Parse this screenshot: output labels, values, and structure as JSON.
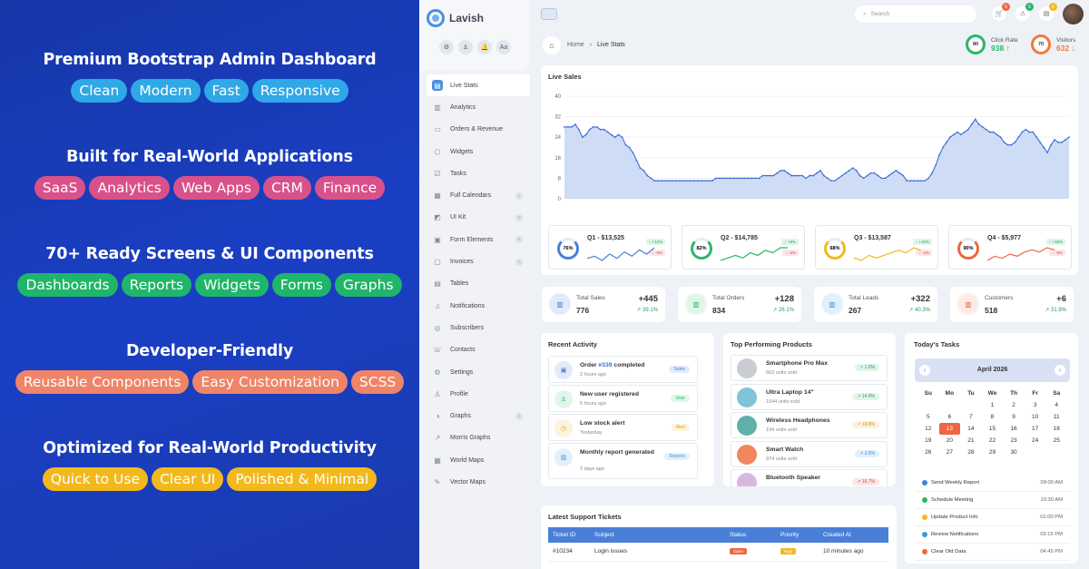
{
  "promo": {
    "sections": [
      {
        "title": "Premium Bootstrap Admin Dashboard",
        "pills": [
          "Clean",
          "Modern",
          "Fast",
          "Responsive"
        ],
        "color": "#2fa8e8"
      },
      {
        "title": "Built for Real-World Applications",
        "pills": [
          "SaaS",
          "Analytics",
          "Web Apps",
          "CRM",
          "Finance"
        ],
        "color": "#d9518a"
      },
      {
        "title": "70+ Ready Screens & UI Components",
        "pills": [
          "Dashboards",
          "Reports",
          "Widgets",
          "Forms",
          "Graphs"
        ],
        "color": "#1fb56a"
      },
      {
        "title": "Developer-Friendly",
        "pills": [
          "Reusable Components",
          "Easy Customization",
          "SCSS"
        ],
        "color": "#ef8468"
      },
      {
        "title": "Optimized for Real-World Productivity",
        "pills": [
          "Quick to Use",
          "Clear UI",
          "Polished & Minimal"
        ],
        "color": "#f2b91d"
      }
    ]
  },
  "brand": {
    "name": "Lavish"
  },
  "side_icons": [
    "⚙",
    "♙",
    "🔔",
    "Aa"
  ],
  "nav": [
    {
      "label": "Live Stats",
      "icon": "▤",
      "active": true
    },
    {
      "label": "Analytics",
      "icon": "▥"
    },
    {
      "label": "Orders & Revenue",
      "icon": "▭"
    },
    {
      "label": "Widgets",
      "icon": "⬡"
    },
    {
      "label": "Tasks",
      "icon": "☑"
    },
    {
      "label": "Full Calendars",
      "icon": "▦",
      "badge": "›"
    },
    {
      "label": "UI Kit",
      "icon": "◩",
      "badge": "›"
    },
    {
      "label": "Form Elements",
      "icon": "▣",
      "badge": "›"
    },
    {
      "label": "Invoices",
      "icon": "▢",
      "badge": "›"
    },
    {
      "label": "Tables",
      "icon": "▤"
    },
    {
      "label": "Notifications",
      "icon": "♫"
    },
    {
      "label": "Subscribers",
      "icon": "◎"
    },
    {
      "label": "Contacts",
      "icon": "☏"
    },
    {
      "label": "Settings",
      "icon": "⚙"
    },
    {
      "label": "Profile",
      "icon": "♙"
    },
    {
      "label": "Graphs",
      "icon": "◑",
      "badge": "›"
    },
    {
      "label": "Morris Graphs",
      "icon": "↗"
    },
    {
      "label": "World Maps",
      "icon": "▦"
    },
    {
      "label": "Vector Maps",
      "icon": "✎"
    }
  ],
  "topbar": {
    "search_placeholder": "Search",
    "badges": [
      {
        "icon": "🛒",
        "count": "5",
        "color": "#f06543"
      },
      {
        "icon": "⚠",
        "count": "5",
        "color": "#2db56a"
      },
      {
        "icon": "▤",
        "count": "6",
        "color": "#f2b91d"
      }
    ]
  },
  "breadcrumb": {
    "home": "Home",
    "current": "Live Stats"
  },
  "kpis": [
    {
      "ring": "80",
      "label": "Click Rate",
      "value": "938 ↑",
      "color": "#2db56a"
    },
    {
      "ring": "70",
      "label": "Visitors",
      "value": "632 ↓",
      "color": "#f07b3f"
    }
  ],
  "live_sales": {
    "title": "Live Sales",
    "chart_data": {
      "type": "area",
      "ylim": [
        0,
        40
      ],
      "yticks": [
        "40",
        "32",
        "24",
        "16",
        "8",
        "0"
      ],
      "values": [
        28,
        28,
        28,
        29,
        27,
        24,
        25,
        27,
        28,
        28,
        27,
        27,
        26,
        25,
        24,
        25,
        24,
        21,
        20,
        18,
        15,
        12,
        11,
        9,
        8,
        7,
        7,
        7,
        7,
        7,
        7,
        7,
        7,
        7,
        7,
        7,
        7,
        7,
        7,
        7,
        7,
        7,
        8,
        8,
        8,
        8,
        8,
        8,
        8,
        8,
        8,
        8,
        8,
        8,
        8,
        9,
        9,
        9,
        9,
        10,
        11,
        11,
        10,
        9,
        9,
        9,
        9,
        8,
        9,
        9,
        10,
        11,
        9,
        8,
        7,
        7,
        8,
        9,
        10,
        11,
        12,
        11,
        9,
        8,
        9,
        10,
        10,
        9,
        8,
        8,
        9,
        10,
        11,
        10,
        9,
        7,
        7,
        7,
        7,
        7,
        7,
        8,
        10,
        13,
        17,
        20,
        22,
        24,
        25,
        26,
        25,
        26,
        27,
        29,
        31,
        29,
        28,
        27,
        26,
        26,
        25,
        24,
        22,
        21,
        21,
        22,
        24,
        26,
        27,
        26,
        26,
        24,
        22,
        20,
        18,
        21,
        23,
        22,
        22,
        23,
        24
      ]
    }
  },
  "quarters": [
    {
      "ring": "76%",
      "title": "Q1 - $13,525",
      "up": "↑ +12%",
      "down": "↓ -5%",
      "color": "#4a7fd8",
      "spark": [
        5,
        6,
        4,
        7,
        5,
        8,
        6,
        9,
        7,
        10
      ]
    },
    {
      "ring": "82%",
      "title": "Q2 - $14,785",
      "up": "↑ +8%",
      "down": "↓ -3%",
      "color": "#2db56a",
      "spark": [
        4,
        5,
        6,
        5,
        7,
        6,
        8,
        7,
        9,
        9
      ]
    },
    {
      "ring": "68%",
      "title": "Q3 - $13,587",
      "up": "↑ +10%",
      "down": "↓ -4%",
      "color": "#f2b91d",
      "spark": [
        5,
        4,
        6,
        5,
        6,
        7,
        8,
        7,
        9,
        8
      ]
    },
    {
      "ring": "90%",
      "title": "Q4 - $5,977",
      "up": "↑ +15%",
      "down": "↓ -6%",
      "color": "#f06543",
      "spark": [
        4,
        6,
        5,
        7,
        6,
        8,
        9,
        8,
        10,
        9
      ]
    }
  ],
  "stats": [
    {
      "label": "Total Sales",
      "value": "776",
      "delta": "+445",
      "pct": "↗ 39.1%",
      "bg": "#e3ebfa",
      "color": "#4a7fd8"
    },
    {
      "label": "Total Orders",
      "value": "834",
      "delta": "+128",
      "pct": "↗ 26.1%",
      "bg": "#e1f5ea",
      "color": "#2db56a"
    },
    {
      "label": "Total Leads",
      "value": "267",
      "delta": "+322",
      "pct": "↗ 40.3%",
      "bg": "#e1f0fb",
      "color": "#3a9ad8"
    },
    {
      "label": "Customers",
      "value": "518",
      "delta": "+6",
      "pct": "↗ 31.8%",
      "bg": "#fdebe6",
      "color": "#f06543"
    }
  ],
  "activity": {
    "title": "Recent Activity",
    "items": [
      {
        "pre": "Order ",
        "link": "#339",
        "post": " completed",
        "time": "2 hours ago",
        "tag": "Sales",
        "bg": "#e3ebfa",
        "color": "#4a7fd8",
        "icon": "▣"
      },
      {
        "pre": "New user registered",
        "link": "",
        "post": "",
        "time": "5 hours ago",
        "tag": "User",
        "bg": "#e1f5ea",
        "color": "#2db56a",
        "icon": "♙"
      },
      {
        "pre": "Low stock alert",
        "link": "",
        "post": "",
        "time": "Yesterday",
        "tag": "Alert",
        "bg": "#fdf3dc",
        "color": "#e0a010",
        "icon": "◷"
      },
      {
        "pre": "Monthly report generated",
        "link": "",
        "post": "",
        "time": "2 days ago",
        "tag": "Reports",
        "bg": "#e1f0fb",
        "color": "#3a9ad8",
        "icon": "▥"
      }
    ]
  },
  "products": {
    "title": "Top Performing Products",
    "items": [
      {
        "name": "Smartphone Pro Max",
        "sold": "563 units sold",
        "pct": "↗ 1.0%",
        "bg": "#e1f5ea",
        "color": "#2a9a5a",
        "img": "#c9ccd2"
      },
      {
        "name": "Ultra Laptop 14\"",
        "sold": "1044 units sold",
        "pct": "↗ 14.9%",
        "bg": "#e1f5ea",
        "color": "#2a9a5a",
        "img": "#7fc4d8"
      },
      {
        "name": "Wireless Headphones",
        "sold": "194 units sold",
        "pct": "↗ 19.8%",
        "bg": "#fdf1dc",
        "color": "#d99010",
        "img": "#5fb0a8"
      },
      {
        "name": "Smart Watch",
        "sold": "974 units sold",
        "pct": "↗ 3.5%",
        "bg": "#e1f0fb",
        "color": "#3a8ad8",
        "img": "#f0875f"
      },
      {
        "name": "Bluetooth Speaker",
        "sold": "",
        "pct": "↗ 16.7%",
        "bg": "#fde6e6",
        "color": "#d44",
        "img": "#d9b8e0"
      }
    ]
  },
  "tasks": {
    "title": "Today's Tasks",
    "month": "April 2026",
    "weekdays": [
      "Su",
      "Mo",
      "Tu",
      "We",
      "Th",
      "Fr",
      "Sa"
    ],
    "days": [
      "",
      "",
      "",
      "1",
      "2",
      "3",
      "4",
      "5",
      "6",
      "7",
      "8",
      "9",
      "10",
      "11",
      "12",
      "13",
      "14",
      "15",
      "16",
      "17",
      "18",
      "19",
      "20",
      "21",
      "22",
      "23",
      "24",
      "25",
      "26",
      "27",
      "28",
      "29",
      "30",
      "",
      ""
    ],
    "today": "13",
    "items": [
      {
        "name": "Send Weekly Report",
        "time": "09:00 AM",
        "color": "#4a7fd8"
      },
      {
        "name": "Schedule Meeting",
        "time": "10:30 AM",
        "color": "#2db56a"
      },
      {
        "name": "Update Product Info",
        "time": "01:00 PM",
        "color": "#f2b91d"
      },
      {
        "name": "Review Notifications",
        "time": "03:15 PM",
        "color": "#3a9ad8"
      },
      {
        "name": "Clear Old Data",
        "time": "04:45 PM",
        "color": "#f06543"
      }
    ]
  },
  "tickets": {
    "title": "Latest Support Tickets",
    "headers": [
      "Ticket ID",
      "Subject",
      "Status",
      "Priority",
      "Created At"
    ],
    "rows": [
      {
        "id": "#10234",
        "subject": "Login issues",
        "status": "Open",
        "status_color": "#f06543",
        "priority": "High",
        "priority_color": "#f2b91d",
        "created": "10 minutes ago"
      }
    ]
  }
}
